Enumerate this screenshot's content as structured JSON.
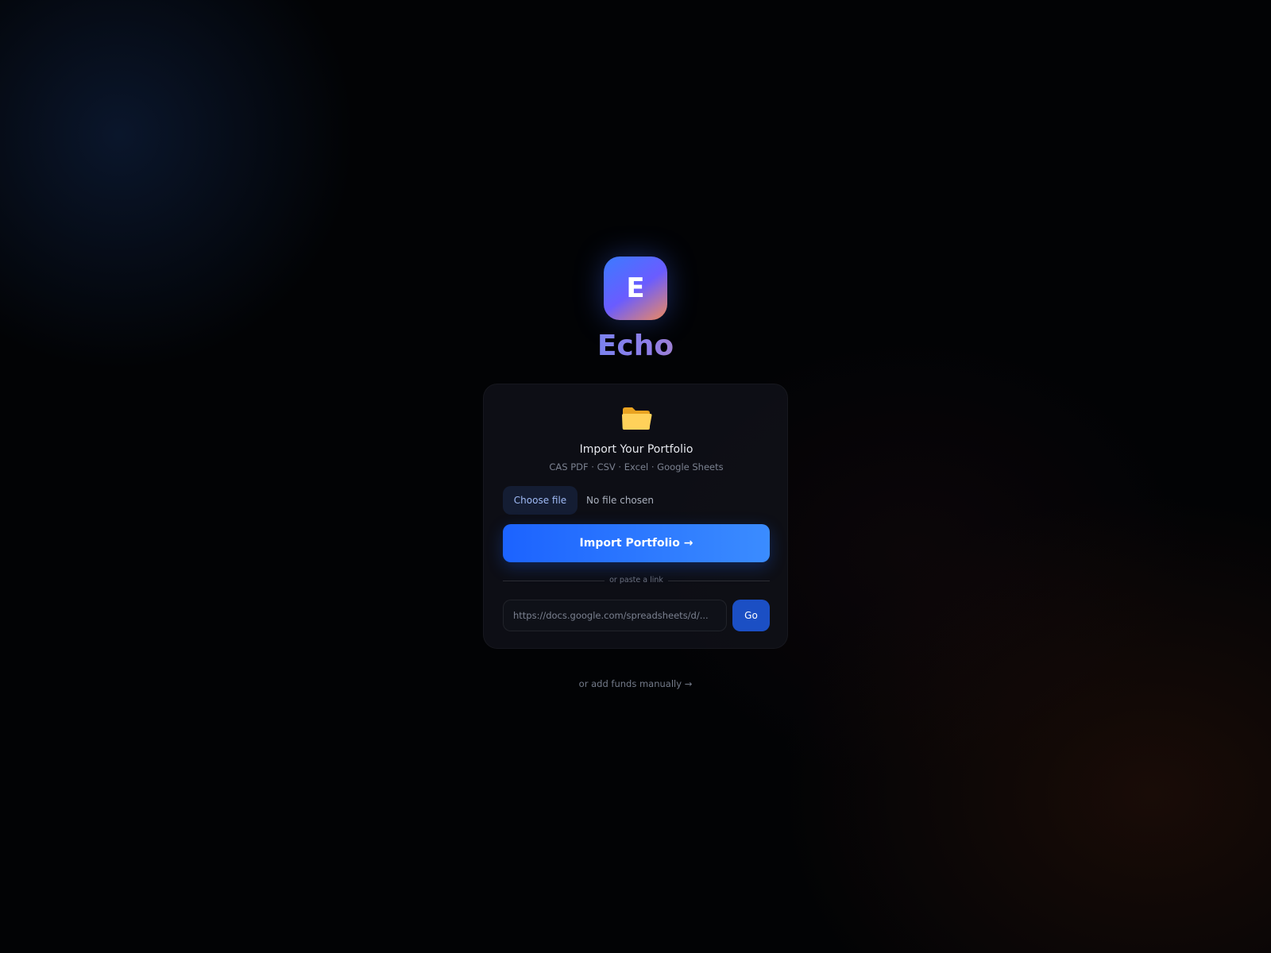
{
  "brand": {
    "logo_letter": "E",
    "app_name": "Echo",
    "colors": {
      "gradient_start": "#3b7bff",
      "gradient_mid": "#6a5cff",
      "gradient_end": "#f08a5d"
    }
  },
  "import_card": {
    "icon": "folder-icon",
    "title": "Import Your Portfolio",
    "formats": "CAS PDF · CSV · Excel · Google Sheets",
    "choose_file_label": "Choose file",
    "file_status": "No file chosen",
    "import_button_label": "Import Portfolio →",
    "divider_text": "or paste a link",
    "link_input": {
      "value": "",
      "placeholder": "https://docs.google.com/spreadsheets/d/..."
    },
    "go_button_label": "Go",
    "colors": {
      "primary": "#1c63ff",
      "go_button": "#1b4fc4",
      "file_button_text": "#9fbaf5"
    }
  },
  "footer": {
    "manual_link": "or add funds manually →"
  }
}
